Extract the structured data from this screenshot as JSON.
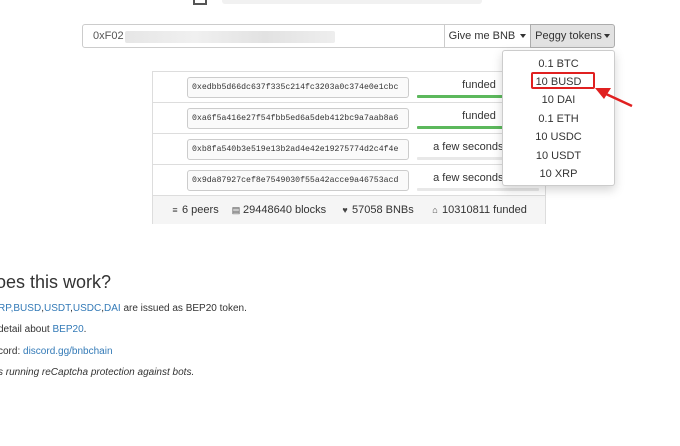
{
  "address": {
    "visible_prefix": "0xF02"
  },
  "buttons": {
    "give_bnb": "Give me BNB",
    "peggy_tokens": "Peggy tokens"
  },
  "dropdown": {
    "items": [
      "0.1 BTC",
      "10 BUSD",
      "10 DAI",
      "0.1 ETH",
      "10 USDC",
      "10 USDT",
      "10 XRP"
    ],
    "highlighted": "10 BUSD"
  },
  "requests": [
    {
      "address": "0xedbb5d66dc637f335c214fc3203a0c374e0e1cbc",
      "status": "funded",
      "progress": 1.0
    },
    {
      "address": "0xa6f5a416e27f54fbb5ed6a5deb412bc9a7aab8a6",
      "status": "funded",
      "progress": 1.0
    },
    {
      "address": "0xb8fa540b3e519e13b2ad4e42e19275774d2c4f4e",
      "status": "a few seconds ago",
      "progress": 0
    },
    {
      "address": "0x9da87927cef8e7549030f55a42acce9a46753acd",
      "status": "a few seconds ago",
      "progress": 0
    }
  ],
  "stats": {
    "peers": "6 peers",
    "blocks": "29448640 blocks",
    "bnbs": "57058 BNBs",
    "funded": "10310811 funded"
  },
  "how": {
    "heading": "oes this work?",
    "line1": {
      "pre": "RP,",
      "link1": "BUSD",
      "sep1": ",",
      "link2": "USDT",
      "sep2": ",",
      "link3": "USDC",
      "sep3": ",",
      "link4": "DAI",
      "post": " are issued as BEP20 token."
    },
    "line2": {
      "pre": "detail about ",
      "link": "BEP20",
      "post": "."
    },
    "line3": {
      "pre": "cord: ",
      "link": "discord.gg/bnbchain"
    },
    "line4": "s running reCaptcha protection against bots."
  },
  "colors": {
    "progress_fill": "#5cb85c",
    "link": "#337ab7",
    "annotation_red": "#e02020"
  }
}
